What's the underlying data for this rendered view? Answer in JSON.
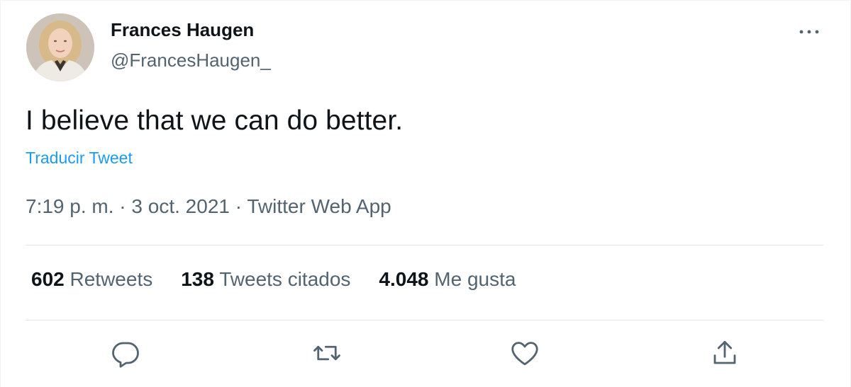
{
  "author": {
    "display_name": "Frances Haugen",
    "handle": "@FrancesHaugen_"
  },
  "tweet": {
    "text": "I believe that we can do better.",
    "translate_label": "Traducir Tweet"
  },
  "meta": {
    "time": "7:19 p. m.",
    "separator": " · ",
    "date": "3 oct. 2021",
    "source": "Twitter Web App"
  },
  "stats": {
    "retweets": {
      "count": "602",
      "label": "Retweets"
    },
    "quotes": {
      "count": "138",
      "label": "Tweets citados"
    },
    "likes": {
      "count": "4.048",
      "label": "Me gusta"
    }
  },
  "actions": {
    "reply_icon": "reply-icon",
    "retweet_icon": "retweet-icon",
    "like_icon": "heart-icon",
    "share_icon": "share-icon"
  },
  "colors": {
    "text_primary": "#0f1419",
    "text_secondary": "#536471",
    "link": "#1d9bf0",
    "divider": "#e1e6ea"
  }
}
